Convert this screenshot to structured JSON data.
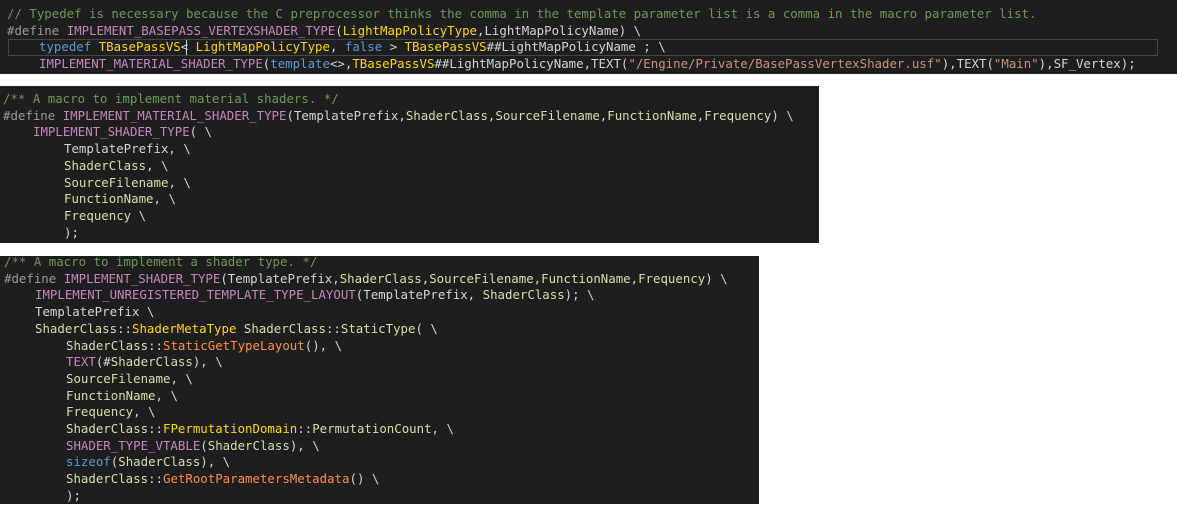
{
  "panels": [
    {
      "lines": [
        {
          "indent": 7,
          "spans": [
            {
              "t": "// Typedef is necessary because the C preprocessor thinks the comma in the template parameter list is a comma in the macro parameter list.",
              "c": "c-com"
            }
          ]
        },
        {
          "indent": 7,
          "spans": [
            {
              "t": "#define ",
              "c": "c-pre"
            },
            {
              "t": "IMPLEMENT_BASEPASS_VERTEXSHADER_TYPE",
              "c": "c-mac"
            },
            {
              "t": "(",
              "c": "c-txt"
            },
            {
              "t": "LightMapPolicyType",
              "c": "c-gold"
            },
            {
              "t": ",LightMapPolicyName) \\",
              "c": "c-txt"
            }
          ]
        },
        {
          "indent": 39,
          "spans": [
            {
              "t": "typedef",
              "c": "c-kw"
            },
            {
              "t": " ",
              "c": "c-txt"
            },
            {
              "t": "TBasePassVS",
              "c": "c-gold"
            },
            {
              "t": "< ",
              "c": "c-txt"
            },
            {
              "t": "LightMapPolicyType",
              "c": "c-gold"
            },
            {
              "t": ", ",
              "c": "c-txt"
            },
            {
              "t": "false",
              "c": "c-kw"
            },
            {
              "t": " > ",
              "c": "c-txt"
            },
            {
              "t": "TBasePassVS",
              "c": "c-gold"
            },
            {
              "t": "##LightMapPolicyName ; \\",
              "c": "c-txt"
            }
          ]
        },
        {
          "indent": 39,
          "spans": [
            {
              "t": "IMPLEMENT_MATERIAL_SHADER_TYPE",
              "c": "c-mac"
            },
            {
              "t": "(",
              "c": "c-txt"
            },
            {
              "t": "template",
              "c": "c-kw"
            },
            {
              "t": "<>,",
              "c": "c-txt"
            },
            {
              "t": "TBasePassVS",
              "c": "c-gold"
            },
            {
              "t": "##LightMapPolicyName,TEXT(",
              "c": "c-txt"
            },
            {
              "t": "\"/Engine/Private/BasePassVertexShader.usf\"",
              "c": "c-str"
            },
            {
              "t": "),TEXT(",
              "c": "c-txt"
            },
            {
              "t": "\"Main\"",
              "c": "c-str"
            },
            {
              "t": "),SF_Vertex);",
              "c": "c-txt"
            }
          ]
        }
      ]
    },
    {
      "lines": [
        {
          "indent": 3,
          "spans": [
            {
              "t": "/** A macro to implement material shaders. */",
              "c": "c-com"
            }
          ]
        },
        {
          "indent": 3,
          "spans": [
            {
              "t": "#define ",
              "c": "c-pre"
            },
            {
              "t": "IMPLEMENT_MATERIAL_SHADER_TYPE",
              "c": "c-mac"
            },
            {
              "t": "(TemplatePrefix,",
              "c": "c-txt"
            },
            {
              "t": "ShaderClass,SourceFilename,FunctionName,Frequency",
              "c": "c-yel"
            },
            {
              "t": ") \\",
              "c": "c-txt"
            }
          ]
        },
        {
          "indent": 33,
          "spans": [
            {
              "t": "IMPLEMENT_SHADER_TYPE",
              "c": "c-mac"
            },
            {
              "t": "( \\",
              "c": "c-txt"
            }
          ]
        },
        {
          "indent": 64,
          "spans": [
            {
              "t": "TemplatePrefix, \\",
              "c": "c-txt"
            }
          ]
        },
        {
          "indent": 64,
          "spans": [
            {
              "t": "ShaderClass",
              "c": "c-yel"
            },
            {
              "t": ", \\",
              "c": "c-txt"
            }
          ]
        },
        {
          "indent": 64,
          "spans": [
            {
              "t": "SourceFilename",
              "c": "c-yel"
            },
            {
              "t": ", \\",
              "c": "c-txt"
            }
          ]
        },
        {
          "indent": 64,
          "spans": [
            {
              "t": "FunctionName",
              "c": "c-yel"
            },
            {
              "t": ", \\",
              "c": "c-txt"
            }
          ]
        },
        {
          "indent": 64,
          "spans": [
            {
              "t": "Frequency",
              "c": "c-yel"
            },
            {
              "t": " \\",
              "c": "c-txt"
            }
          ]
        },
        {
          "indent": 64,
          "spans": [
            {
              "t": ");",
              "c": "c-txt"
            }
          ]
        }
      ]
    },
    {
      "lines": [
        {
          "indent": 4,
          "spans": [
            {
              "t": "/** A macro to implement a shader type. */",
              "c": "c-com"
            }
          ]
        },
        {
          "indent": 4,
          "spans": [
            {
              "t": "#define ",
              "c": "c-pre"
            },
            {
              "t": "IMPLEMENT_SHADER_TYPE",
              "c": "c-mac"
            },
            {
              "t": "(TemplatePrefix,",
              "c": "c-txt"
            },
            {
              "t": "ShaderClass,SourceFilename,FunctionName,Frequency",
              "c": "c-yel"
            },
            {
              "t": ") \\",
              "c": "c-txt"
            }
          ]
        },
        {
          "indent": 35,
          "spans": [
            {
              "t": "IMPLEMENT_UNREGISTERED_TEMPLATE_TYPE_LAYOUT",
              "c": "c-mac"
            },
            {
              "t": "(TemplatePrefix, ",
              "c": "c-txt"
            },
            {
              "t": "ShaderClass",
              "c": "c-yel"
            },
            {
              "t": "); \\",
              "c": "c-txt"
            }
          ]
        },
        {
          "indent": 35,
          "spans": [
            {
              "t": "TemplatePrefix \\",
              "c": "c-txt"
            }
          ]
        },
        {
          "indent": 35,
          "spans": [
            {
              "t": "ShaderClass",
              "c": "c-yel"
            },
            {
              "t": "::",
              "c": "c-txt"
            },
            {
              "t": "ShaderMetaType",
              "c": "c-gold"
            },
            {
              "t": " ",
              "c": "c-txt"
            },
            {
              "t": "ShaderClass",
              "c": "c-yel"
            },
            {
              "t": "::",
              "c": "c-txt"
            },
            {
              "t": "StaticType",
              "c": "c-yel"
            },
            {
              "t": "( \\",
              "c": "c-txt"
            }
          ]
        },
        {
          "indent": 66,
          "spans": [
            {
              "t": "ShaderClass",
              "c": "c-yel"
            },
            {
              "t": "::",
              "c": "c-txt"
            },
            {
              "t": "StaticGetTypeLayout",
              "c": "c-fn"
            },
            {
              "t": "(), \\",
              "c": "c-txt"
            }
          ]
        },
        {
          "indent": 66,
          "spans": [
            {
              "t": "TEXT",
              "c": "c-mac"
            },
            {
              "t": "(#",
              "c": "c-txt"
            },
            {
              "t": "ShaderClass",
              "c": "c-yel"
            },
            {
              "t": "), \\",
              "c": "c-txt"
            }
          ]
        },
        {
          "indent": 66,
          "spans": [
            {
              "t": "SourceFilename",
              "c": "c-yel"
            },
            {
              "t": ", \\",
              "c": "c-txt"
            }
          ]
        },
        {
          "indent": 66,
          "spans": [
            {
              "t": "FunctionName",
              "c": "c-yel"
            },
            {
              "t": ", \\",
              "c": "c-txt"
            }
          ]
        },
        {
          "indent": 66,
          "spans": [
            {
              "t": "Frequency",
              "c": "c-yel"
            },
            {
              "t": ", \\",
              "c": "c-txt"
            }
          ]
        },
        {
          "indent": 66,
          "spans": [
            {
              "t": "ShaderClass",
              "c": "c-yel"
            },
            {
              "t": "::",
              "c": "c-txt"
            },
            {
              "t": "FPermutationDomain",
              "c": "c-gold"
            },
            {
              "t": "::",
              "c": "c-txt"
            },
            {
              "t": "PermutationCount",
              "c": "c-yel"
            },
            {
              "t": ", \\",
              "c": "c-txt"
            }
          ]
        },
        {
          "indent": 66,
          "spans": [
            {
              "t": "SHADER_TYPE_VTABLE",
              "c": "c-mac"
            },
            {
              "t": "(",
              "c": "c-txt"
            },
            {
              "t": "ShaderClass",
              "c": "c-yel"
            },
            {
              "t": "), \\",
              "c": "c-txt"
            }
          ]
        },
        {
          "indent": 66,
          "spans": [
            {
              "t": "sizeof",
              "c": "c-kw"
            },
            {
              "t": "(",
              "c": "c-txt"
            },
            {
              "t": "ShaderClass",
              "c": "c-yel"
            },
            {
              "t": "), \\",
              "c": "c-txt"
            }
          ]
        },
        {
          "indent": 66,
          "spans": [
            {
              "t": "ShaderClass",
              "c": "c-yel"
            },
            {
              "t": "::",
              "c": "c-txt"
            },
            {
              "t": "GetRootParametersMetadata",
              "c": "c-fn"
            },
            {
              "t": "() \\",
              "c": "c-txt"
            }
          ]
        },
        {
          "indent": 66,
          "spans": [
            {
              "t": ");",
              "c": "c-txt"
            }
          ]
        }
      ]
    }
  ]
}
